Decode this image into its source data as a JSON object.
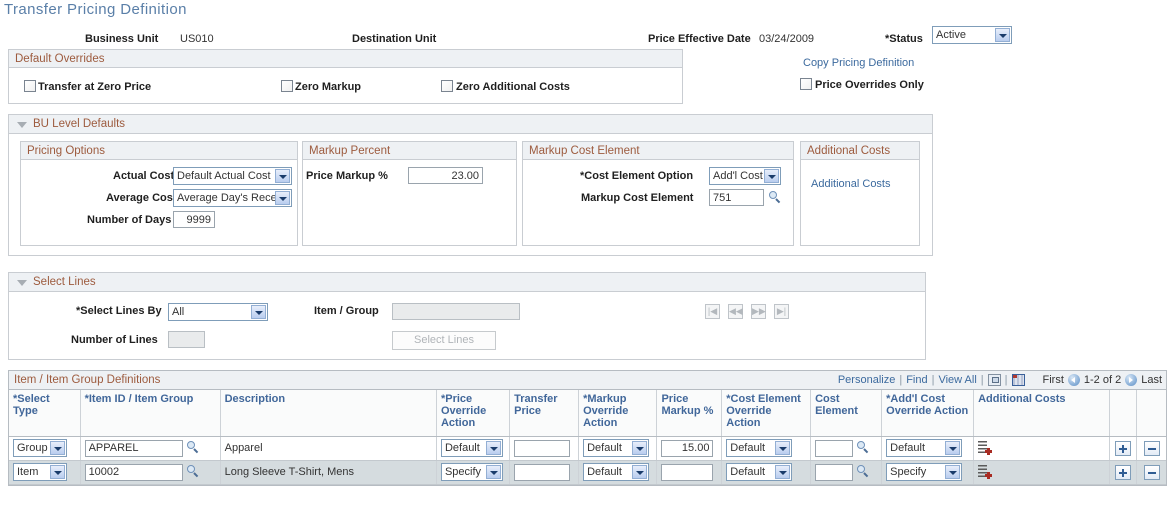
{
  "page": {
    "title": "Transfer Pricing Definition"
  },
  "header": {
    "business_unit_label": "Business Unit",
    "business_unit_value": "US010",
    "destination_unit_label": "Destination Unit",
    "destination_unit_value": "",
    "price_effective_date_label": "Price Effective Date",
    "price_effective_date_value": "03/24/2009",
    "status_label": "*Status",
    "status_value": "Active"
  },
  "default_overrides": {
    "title": "Default Overrides",
    "checkboxes": [
      {
        "label": "Transfer at Zero Price",
        "checked": false
      },
      {
        "label": "Zero Markup",
        "checked": false
      },
      {
        "label": "Zero Additional Costs",
        "checked": false
      }
    ],
    "copy_link": "Copy Pricing Definition",
    "price_overrides_only_label": "Price Overrides Only",
    "price_overrides_only_checked": false
  },
  "bu_level_defaults": {
    "title": "BU Level Defaults",
    "pricing_options": {
      "title": "Pricing Options",
      "actual_cost_label": "Actual Cost",
      "actual_cost_value": "Default Actual Cost",
      "average_cost_label": "Average Cost",
      "average_cost_value": "Average Day's Receipt",
      "number_of_days_label": "Number of Days",
      "number_of_days_value": "9999"
    },
    "markup_percent": {
      "title": "Markup Percent",
      "price_markup_label": "Price Markup %",
      "price_markup_value": "23.00"
    },
    "markup_cost_element": {
      "title": "Markup Cost Element",
      "cost_element_option_label": "*Cost Element Option",
      "cost_element_option_value": "Add'l Cost",
      "markup_cost_element_label": "Markup Cost Element",
      "markup_cost_element_value": "751"
    },
    "additional_costs": {
      "title": "Additional Costs",
      "link": "Additional Costs"
    }
  },
  "select_lines": {
    "title": "Select Lines",
    "select_lines_by_label": "*Select Lines By",
    "select_lines_by_value": "All",
    "item_group_label": "Item / Group",
    "item_group_value": "",
    "number_of_lines_label": "Number of Lines",
    "number_of_lines_value": "",
    "select_lines_button": "Select Lines",
    "nav_buttons": [
      "first",
      "prev",
      "next",
      "last"
    ]
  },
  "grid": {
    "title": "Item / Item Group Definitions",
    "tools": {
      "personalize": "Personalize",
      "find": "Find",
      "view_all": "View All",
      "sep": "|",
      "new_window_icon": "new-window-icon",
      "download_grid_icon": "download-grid-icon"
    },
    "pager": {
      "first": "First",
      "range": "1-2 of 2",
      "last": "Last"
    },
    "columns": [
      "*Select Type",
      "*Item ID / Item Group",
      "Description",
      "*Price Override Action",
      "Transfer Price",
      "*Markup Override Action",
      "Price Markup %",
      "*Cost Element Override Action",
      "Cost Element",
      "*Add'l Cost Override Action",
      "Additional Costs",
      "",
      ""
    ],
    "rows": [
      {
        "select_type": "Group",
        "item_id": "APPAREL",
        "description": "Apparel",
        "price_override_action": "Default",
        "transfer_price": "",
        "markup_override_action": "Default",
        "price_markup_pct": "15.00",
        "cost_element_override_action": "Default",
        "cost_element": "",
        "addl_cost_override_action": "Default",
        "additional_costs_icon": "add-additional-costs-icon",
        "add_label": "+",
        "remove_label": "-"
      },
      {
        "select_type": "Item",
        "item_id": "10002",
        "description": "Long Sleeve T-Shirt, Mens",
        "price_override_action": "Specify",
        "transfer_price": "",
        "markup_override_action": "Default",
        "price_markup_pct": "",
        "cost_element_override_action": "Default",
        "cost_element": "",
        "addl_cost_override_action": "Specify",
        "additional_costs_icon": "add-additional-costs-icon",
        "add_label": "+",
        "remove_label": "-"
      }
    ]
  },
  "colors": {
    "title": "#5a7fa8",
    "section_header_text": "#9d5b3e",
    "section_header_bg": "#eef1f4",
    "link": "#3c6a9e",
    "grid_header_text": "#41679a",
    "alt_row_bg": "#d5dcdf"
  }
}
